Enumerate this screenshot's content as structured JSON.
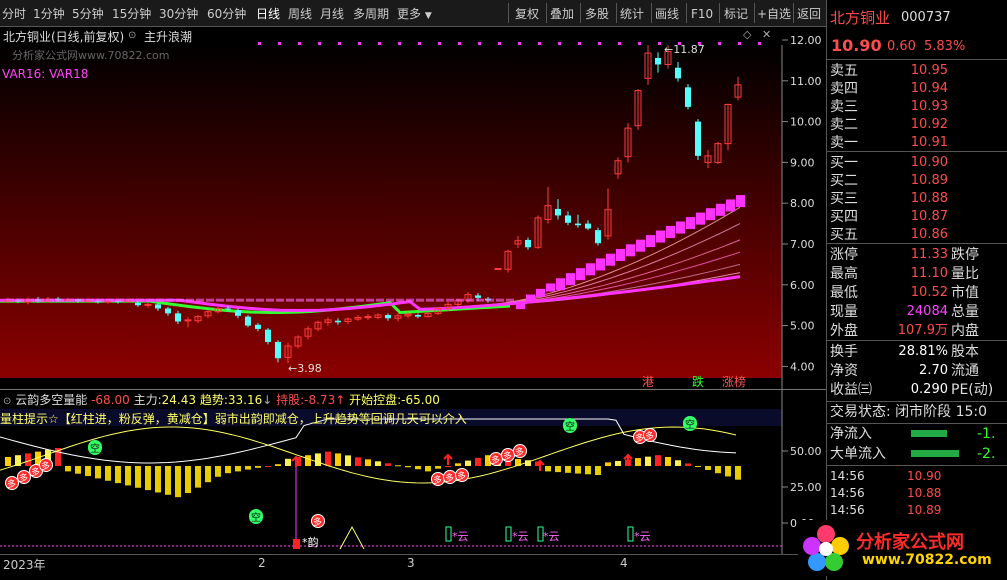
{
  "toolbar": {
    "items": [
      "分时",
      "1分钟",
      "5分钟",
      "15分钟",
      "30分钟",
      "60分钟",
      "日线",
      "周线",
      "月线",
      "多周期",
      "更多"
    ],
    "right_items": [
      "复权",
      "叠加",
      "多股",
      "统计",
      "画线",
      "F10",
      "标记",
      "+自选",
      "返回"
    ]
  },
  "chart": {
    "title": "北方铜业(日线,前复权)",
    "indicator_name": "主升浪潮",
    "watermark": "分析家公式网www.70822.com",
    "var_label": "VAR16: VAR18",
    "high_label": "11.87",
    "low_label": "3.98",
    "price_ticks": [
      "12.00",
      "11.00",
      "10.00",
      "9.00",
      "8.00",
      "7.00",
      "6.00",
      "5.00",
      "4.00"
    ],
    "tags": [
      "港",
      "跌",
      "涨榜"
    ],
    "colors": {
      "up": "#ff3b3b",
      "down": "#54ffff",
      "bg_top": "#000000",
      "bg_bottom": "#8b0000",
      "magenta": "#ff33ff",
      "green": "#33ff33"
    }
  },
  "indicator": {
    "name": "云韵多空量能",
    "val1": "-68.00",
    "zl_label": "主力:",
    "zl_val": "24.43",
    "qs_label": "趋势:",
    "qs_val": "33.16",
    "cg_label": "持股:",
    "cg_val": "-8.73",
    "kk_label": "开始控盘:",
    "kk_val": "-65.00",
    "hint": "量柱提示☆【红柱进，粉反弹，黄减仓】弱市出韵即减仓，上升趋势等回调几天可以介入",
    "ticks": [
      "50.00",
      "25.00",
      "0.00"
    ],
    "kong": "空",
    "duo": "多",
    "yun": "*云",
    "yun2": "*韵"
  },
  "date_axis": {
    "labels": [
      "2023年",
      "2",
      "3",
      "4"
    ]
  },
  "sidepanel": {
    "name": "北方铜业",
    "code": "000737",
    "price": "10.90",
    "change": "0.60",
    "pct": "5.83%",
    "asks": [
      {
        "label": "卖五",
        "price": "10.95"
      },
      {
        "label": "卖四",
        "price": "10.94"
      },
      {
        "label": "卖三",
        "price": "10.93"
      },
      {
        "label": "卖二",
        "price": "10.92"
      },
      {
        "label": "卖一",
        "price": "10.91"
      }
    ],
    "bids": [
      {
        "label": "买一",
        "price": "10.90"
      },
      {
        "label": "买二",
        "price": "10.89"
      },
      {
        "label": "买三",
        "price": "10.88"
      },
      {
        "label": "买四",
        "price": "10.87"
      },
      {
        "label": "买五",
        "price": "10.86"
      }
    ],
    "stats": [
      {
        "label": "涨停",
        "value": "11.33",
        "right": "跌停",
        "color": "#ff4c4c"
      },
      {
        "label": "最高",
        "value": "11.10",
        "right": "量比",
        "color": "#ff4c4c"
      },
      {
        "label": "最低",
        "value": "10.52",
        "right": "市值",
        "color": "#ff4c4c"
      },
      {
        "label": "现量",
        "value": "24084",
        "right": "总量",
        "color": "#ff44ff"
      },
      {
        "label": "外盘",
        "value": "107.9万",
        "right": "内盘",
        "color": "#ff4c4c"
      }
    ],
    "stats2": [
      {
        "label": "换手",
        "value": "28.81%",
        "right": "股本",
        "color": "#ffffff"
      },
      {
        "label": "净资",
        "value": "2.70",
        "right": "流通",
        "color": "#ffffff"
      },
      {
        "label": "收益㈢",
        "value": "0.290",
        "right": "PE(动)",
        "color": "#ffffff"
      }
    ],
    "trade_state": "交易状态: 闭市阶段 15:0",
    "flows": [
      {
        "label": "净流入",
        "value": "-1."
      },
      {
        "label": "大单流入",
        "value": "-2."
      }
    ],
    "ticks": [
      {
        "time": "14:56",
        "price": "10.90"
      },
      {
        "time": "14:56",
        "price": "10.88"
      },
      {
        "time": "14:56",
        "price": "10.89"
      }
    ]
  },
  "logo": {
    "text1": "分析家公式网",
    "text2": "www.70822.com"
  }
}
